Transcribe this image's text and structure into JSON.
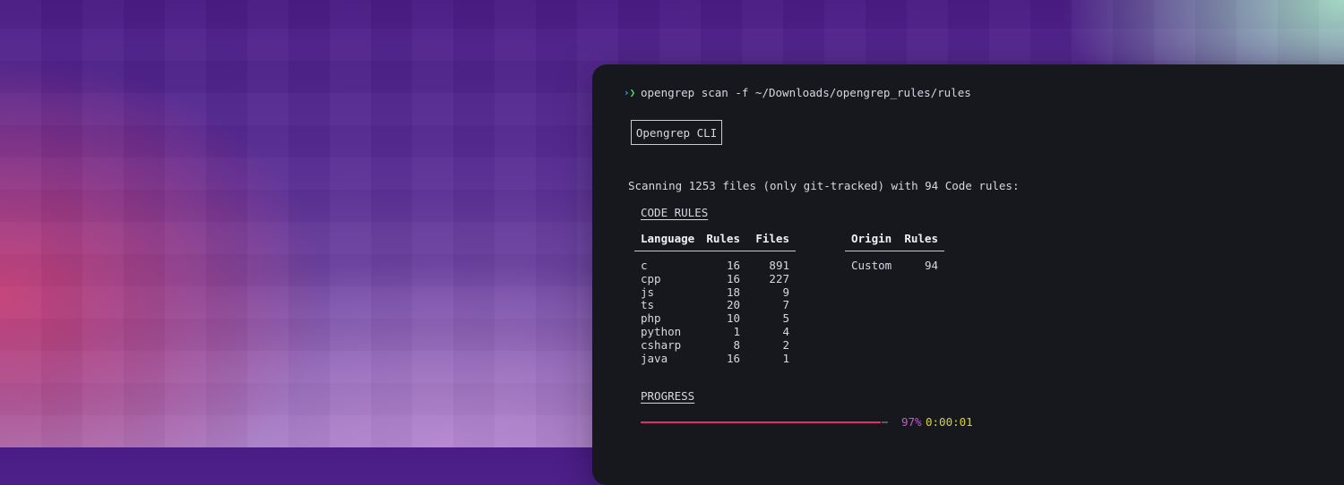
{
  "terminal": {
    "prompt_symbol": "❯",
    "command": "opengrep scan -f ~/Downloads/opengrep_rules/rules",
    "banner": "Opengrep CLI",
    "scan_summary": "Scanning 1253 files (only git-tracked) with 94 Code rules:",
    "code_rules": {
      "title": "CODE RULES",
      "language_table": {
        "headers": [
          "Language",
          "Rules",
          "Files"
        ],
        "rows": [
          [
            "c",
            "16",
            "891"
          ],
          [
            "cpp",
            "16",
            "227"
          ],
          [
            "js",
            "18",
            "9"
          ],
          [
            "ts",
            "20",
            "7"
          ],
          [
            "php",
            "10",
            "5"
          ],
          [
            "python",
            "1",
            "4"
          ],
          [
            "csharp",
            "8",
            "2"
          ],
          [
            "java",
            "16",
            "1"
          ]
        ]
      },
      "origin_table": {
        "headers": [
          "Origin",
          "Rules"
        ],
        "rows": [
          [
            "Custom",
            "94"
          ]
        ]
      }
    },
    "progress": {
      "title": "PROGRESS",
      "fraction": 0.97,
      "percent_label": "97%",
      "elapsed": "0:00:01"
    }
  },
  "colors": {
    "terminal_bg": "#16181e",
    "prompt_green": "#4cd964",
    "progress_bar": "#e0306a",
    "percent_text": "#c45ac8",
    "elapsed_text": "#d8d23a"
  }
}
